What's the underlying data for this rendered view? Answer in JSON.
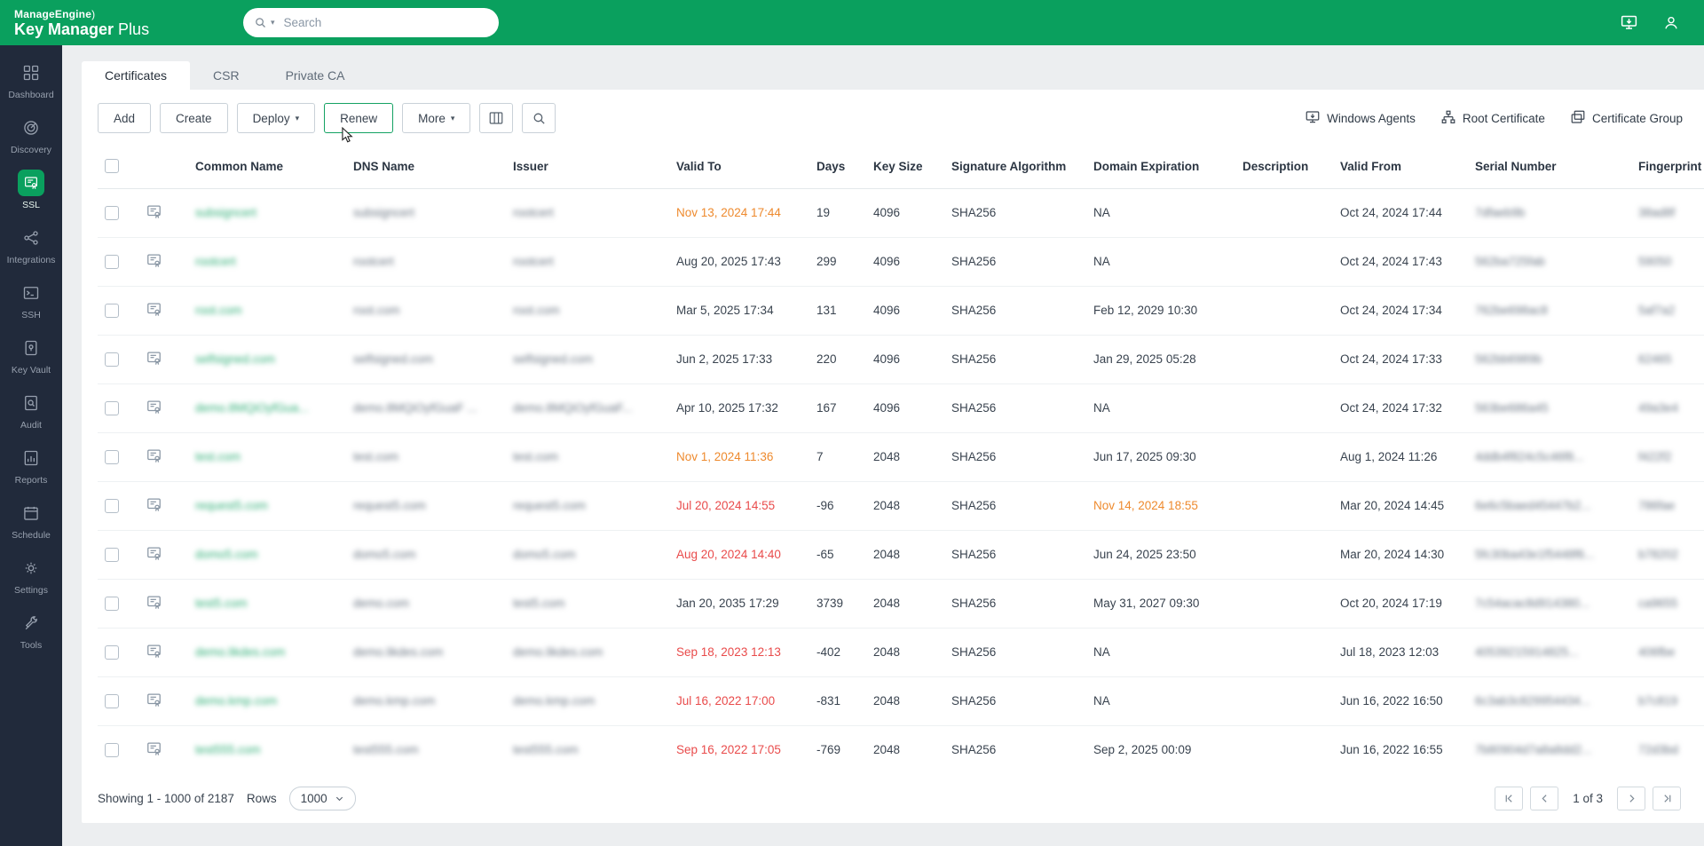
{
  "topbar": {
    "brand_top": "ManageEngine",
    "brand_main": "Key Manager",
    "brand_suffix": " Plus",
    "search": {
      "placeholder": "Search"
    },
    "accent_color": "#0aa05e"
  },
  "sidebar": {
    "items": [
      {
        "label": "Dashboard",
        "icon": "dashboard",
        "active": false
      },
      {
        "label": "Discovery",
        "icon": "discovery",
        "active": false
      },
      {
        "label": "SSL",
        "icon": "ssl",
        "active": true
      },
      {
        "label": "Integrations",
        "icon": "integrations",
        "active": false
      },
      {
        "label": "SSH",
        "icon": "ssh",
        "active": false
      },
      {
        "label": "Key Vault",
        "icon": "key-vault",
        "active": false
      },
      {
        "label": "Audit",
        "icon": "audit",
        "active": false
      },
      {
        "label": "Reports",
        "icon": "reports",
        "active": false
      },
      {
        "label": "Schedule",
        "icon": "schedule",
        "active": false
      },
      {
        "label": "Settings",
        "icon": "settings",
        "active": false
      },
      {
        "label": "Tools",
        "icon": "tools",
        "active": false
      }
    ]
  },
  "tabs": [
    {
      "label": "Certificates",
      "active": true
    },
    {
      "label": "CSR",
      "active": false
    },
    {
      "label": "Private CA",
      "active": false
    }
  ],
  "toolbar": {
    "add": "Add",
    "create": "Create",
    "deploy": "Deploy",
    "renew": "Renew",
    "more": "More",
    "links": [
      {
        "label": "Windows Agents",
        "icon": "windows-agents"
      },
      {
        "label": "Root Certificate",
        "icon": "root-certificate"
      },
      {
        "label": "Certificate Group",
        "icon": "certificate-group"
      }
    ]
  },
  "table": {
    "headers": [
      "Common Name",
      "DNS Name",
      "Issuer",
      "Valid To",
      "Days",
      "Key Size",
      "Signature Algorithm",
      "Domain Expiration",
      "Description",
      "Valid From",
      "Serial Number",
      "Fingerprint"
    ],
    "status_colors": {
      "warn": "#ee8a2e",
      "expired": "#e94b4b"
    },
    "rows": [
      {
        "common_name": "subsigncert",
        "dns_name": "subsigncert",
        "issuer": "rootcert",
        "valid_to": "Nov 13, 2024 17:44",
        "valid_to_state": "warn",
        "days": "19",
        "key_size": "4096",
        "signature_algorithm": "SHA256",
        "domain_expiration": "NA",
        "domain_expiration_state": "",
        "description": "",
        "valid_from": "Oct 24, 2024 17:44",
        "serial_number": "7dfaeb9b",
        "fingerprint": "38ad8f"
      },
      {
        "common_name": "rootcert",
        "dns_name": "rootcert",
        "issuer": "rootcert",
        "valid_to": "Aug 20, 2025 17:43",
        "valid_to_state": "",
        "days": "299",
        "key_size": "4096",
        "signature_algorithm": "SHA256",
        "domain_expiration": "NA",
        "domain_expiration_state": "",
        "description": "",
        "valid_from": "Oct 24, 2024 17:43",
        "serial_number": "562ba725fab",
        "fingerprint": "59050"
      },
      {
        "common_name": "root.com",
        "dns_name": "root.com",
        "issuer": "root.com",
        "valid_to": "Mar 5, 2025 17:34",
        "valid_to_state": "",
        "days": "131",
        "key_size": "4096",
        "signature_algorithm": "SHA256",
        "domain_expiration": "Feb 12, 2029 10:30",
        "domain_expiration_state": "",
        "description": "",
        "valid_from": "Oct 24, 2024 17:34",
        "serial_number": "762be698ac8",
        "fingerprint": "5af7a2"
      },
      {
        "common_name": "selfsigned.com",
        "dns_name": "selfsigned.com",
        "issuer": "selfsigned.com",
        "valid_to": "Jun 2, 2025 17:33",
        "valid_to_state": "",
        "days": "220",
        "key_size": "4096",
        "signature_algorithm": "SHA256",
        "domain_expiration": "Jan 29, 2025 05:28",
        "domain_expiration_state": "",
        "description": "",
        "valid_from": "Oct 24, 2024 17:33",
        "serial_number": "562bb6989b",
        "fingerprint": "62465"
      },
      {
        "common_name": "demo.8MQiOyfGua...",
        "dns_name": "demo.8MQiOyfGuaF ...",
        "issuer": "demo.8MQiOyfGuaF...",
        "valid_to": "Apr 10, 2025 17:32",
        "valid_to_state": "",
        "days": "167",
        "key_size": "4096",
        "signature_algorithm": "SHA256",
        "domain_expiration": "NA",
        "domain_expiration_state": "",
        "description": "",
        "valid_from": "Oct 24, 2024 17:32",
        "serial_number": "563be686a45",
        "fingerprint": "49a3e4"
      },
      {
        "common_name": "test.com",
        "dns_name": "test.com",
        "issuer": "test.com",
        "valid_to": "Nov 1, 2024 11:36",
        "valid_to_state": "warn",
        "days": "7",
        "key_size": "2048",
        "signature_algorithm": "SHA256",
        "domain_expiration": "Jun 17, 2025 09:30",
        "domain_expiration_state": "",
        "description": "",
        "valid_from": "Aug 1, 2024 11:26",
        "serial_number": "4ddb4f824c5c46f8...",
        "fingerprint": "f422f2"
      },
      {
        "common_name": "request5.com",
        "dns_name": "request5.com",
        "issuer": "request5.com",
        "valid_to": "Jul 20, 2024 14:55",
        "valid_to_state": "expired",
        "days": "-96",
        "key_size": "2048",
        "signature_algorithm": "SHA256",
        "domain_expiration": "Nov 14, 2024 18:55",
        "domain_expiration_state": "warn",
        "description": "",
        "valid_from": "Mar 20, 2024 14:45",
        "serial_number": "6e6c5baed45447b2...",
        "fingerprint": "786fae"
      },
      {
        "common_name": "domo5.com",
        "dns_name": "domo5.com",
        "issuer": "domo5.com",
        "valid_to": "Aug 20, 2024 14:40",
        "valid_to_state": "expired",
        "days": "-65",
        "key_size": "2048",
        "signature_algorithm": "SHA256",
        "domain_expiration": "Jun 24, 2025 23:50",
        "domain_expiration_state": "",
        "description": "",
        "valid_from": "Mar 20, 2024 14:30",
        "serial_number": "5fc30ba43e1f5448f6...",
        "fingerprint": "b78202"
      },
      {
        "common_name": "test5.com",
        "dns_name": "demo.com",
        "issuer": "test5.com",
        "valid_to": "Jan 20, 2035 17:29",
        "valid_to_state": "",
        "days": "3739",
        "key_size": "2048",
        "signature_algorithm": "SHA256",
        "domain_expiration": "May 31, 2027 09:30",
        "domain_expiration_state": "",
        "description": "",
        "valid_from": "Oct 20, 2024 17:19",
        "serial_number": "7c54acac8d914380...",
        "fingerprint": "ca9655"
      },
      {
        "common_name": "demo.likdes.com",
        "dns_name": "demo.likdes.com",
        "issuer": "demo.likdes.com",
        "valid_to": "Sep 18, 2023 12:13",
        "valid_to_state": "expired",
        "days": "-402",
        "key_size": "2048",
        "signature_algorithm": "SHA256",
        "domain_expiration": "NA",
        "domain_expiration_state": "",
        "description": "",
        "valid_from": "Jul 18, 2023 12:03",
        "serial_number": "40539215914825...",
        "fingerprint": "406fbe"
      },
      {
        "common_name": "demo.kmp.com",
        "dns_name": "demo.kmp.com",
        "issuer": "demo.kmp.com",
        "valid_to": "Jul 16, 2022 17:00",
        "valid_to_state": "expired",
        "days": "-831",
        "key_size": "2048",
        "signature_algorithm": "SHA256",
        "domain_expiration": "NA",
        "domain_expiration_state": "",
        "description": "",
        "valid_from": "Jun 16, 2022 16:50",
        "serial_number": "6c3ab3c829954434...",
        "fingerprint": "b7c819"
      },
      {
        "common_name": "test555.com",
        "dns_name": "test555.com",
        "issuer": "test555.com",
        "valid_to": "Sep 16, 2022 17:05",
        "valid_to_state": "expired",
        "days": "-769",
        "key_size": "2048",
        "signature_algorithm": "SHA256",
        "domain_expiration": "Sep 2, 2025 00:09",
        "domain_expiration_state": "",
        "description": "",
        "valid_from": "Jun 16, 2022 16:55",
        "serial_number": "7b80904d7a8a8dd2...",
        "fingerprint": "72d3bd"
      }
    ]
  },
  "footer": {
    "showing": "Showing 1 - 1000 of 2187",
    "rows_label": "Rows",
    "rows_value": "1000",
    "page_status": "1 of 3"
  }
}
